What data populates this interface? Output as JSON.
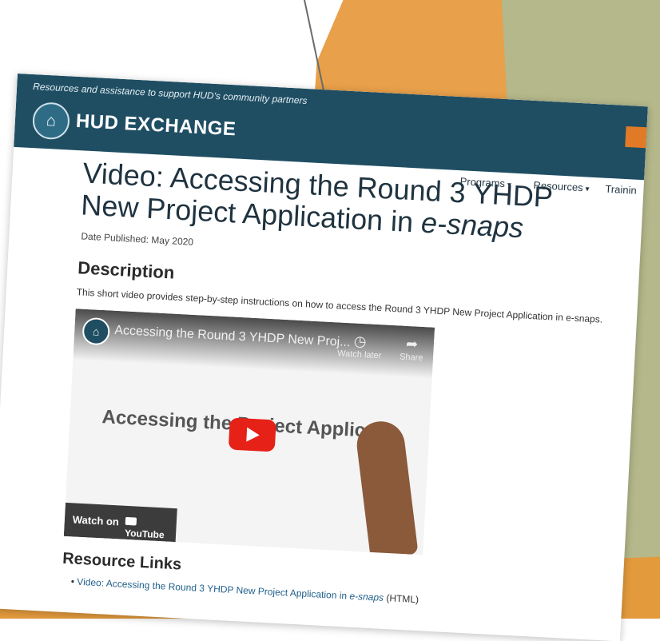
{
  "header": {
    "tagline": "Resources and assistance to support HUD's community partners",
    "brand": "HUD EXCHANGE",
    "brand_colors": {
      "header_bg": "#1f4e63",
      "accent": "#e07a26"
    }
  },
  "nav": {
    "items": [
      {
        "label": "Programs"
      },
      {
        "label": "Resources"
      },
      {
        "label": "Trainin"
      }
    ]
  },
  "page": {
    "title_main": "Video: Accessing the Round 3 YHDP New Project Application in ",
    "title_em": "e-snaps",
    "date_published": "Date Published: May 2020",
    "description_heading": "Description",
    "description_text": "This short video provides step-by-step instructions on how to access the Round 3 YHDP New Project Application in e-snaps."
  },
  "video": {
    "title": "Accessing the Round 3 YHDP New Proj...",
    "watch_later_label": "Watch later",
    "share_label": "Share",
    "overlay_text": "Accessing the Project Applic",
    "watch_on_label": "Watch on",
    "youtube_label": "YouTube",
    "play_icon": "play-icon",
    "colors": {
      "play_button": "#e62117"
    }
  },
  "resources": {
    "heading": "Resource Links",
    "link_text_main": "Video: Accessing the Round 3 YHDP New Project Application in ",
    "link_text_em": "e-snaps",
    "link_suffix": " (HTML)"
  }
}
